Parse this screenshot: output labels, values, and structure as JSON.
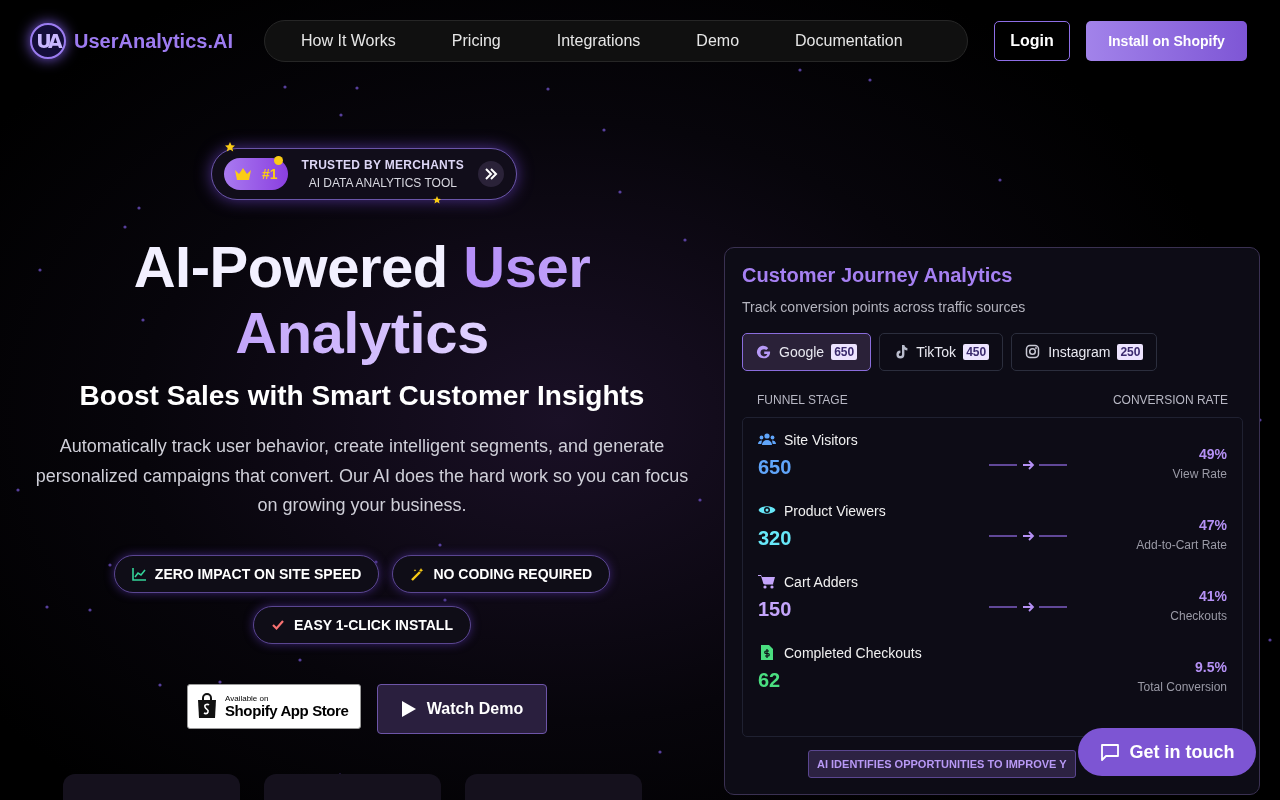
{
  "brand": {
    "logo": "UA",
    "name": "UserAnalytics.AI"
  },
  "nav": [
    "How It Works",
    "Pricing",
    "Integrations",
    "Demo",
    "Documentation"
  ],
  "header_actions": {
    "login": "Login",
    "install": "Install on Shopify"
  },
  "hero": {
    "badge": {
      "rank": "#1",
      "title": "TRUSTED BY MERCHANTS",
      "subtitle": "AI DATA ANALYTICS TOOL"
    },
    "heading": {
      "lead": "AI-Powered",
      "accent": "User Analytics"
    },
    "subheading": "Boost Sales with Smart Customer Insights",
    "description": "Automatically track user behavior, create intelligent segments, and generate personalized campaigns that convert. Our AI does the hard work so you can focus on growing your business.",
    "features": [
      {
        "label": "ZERO IMPACT ON SITE SPEED",
        "kind": "chart"
      },
      {
        "label": "NO CODING REQUIRED",
        "kind": "wand"
      },
      {
        "label": "EASY 1-CLICK INSTALL",
        "kind": "check"
      }
    ],
    "store_badge": {
      "small": "Available on",
      "large": "Shopify App Store"
    },
    "demo_button": "Watch Demo"
  },
  "journey": {
    "title": "Customer Journey Analytics",
    "subtitle": "Track conversion points across traffic sources",
    "sources": [
      {
        "label": "Google",
        "count": "650",
        "kind": "google",
        "selected": true
      },
      {
        "label": "TikTok",
        "count": "450",
        "kind": "tiktok",
        "selected": false
      },
      {
        "label": "Instagram",
        "count": "250",
        "kind": "instagram",
        "selected": false
      }
    ],
    "columns": [
      "FUNNEL STAGE",
      "CONVERSION RATE"
    ],
    "stages": [
      {
        "name": "Site Visitors",
        "value": "650",
        "rate": "49%",
        "rate_label": "View Rate",
        "kind": "users",
        "color": "#60a5fa"
      },
      {
        "name": "Product Viewers",
        "value": "320",
        "rate": "47%",
        "rate_label": "Add-to-Cart Rate",
        "kind": "eye",
        "color": "#67e8f9"
      },
      {
        "name": "Cart Adders",
        "value": "150",
        "rate": "41%",
        "rate_label": "Checkouts",
        "kind": "cart",
        "color": "#c4a5fb"
      },
      {
        "name": "Completed Checkouts",
        "value": "62",
        "rate": "9.5%",
        "rate_label": "Total Conversion",
        "kind": "receipt",
        "color": "#4ade80"
      }
    ],
    "note": "AI IDENTIFIES OPPORTUNITIES TO IMPROVE Y"
  },
  "contact_button": "Get in touch"
}
